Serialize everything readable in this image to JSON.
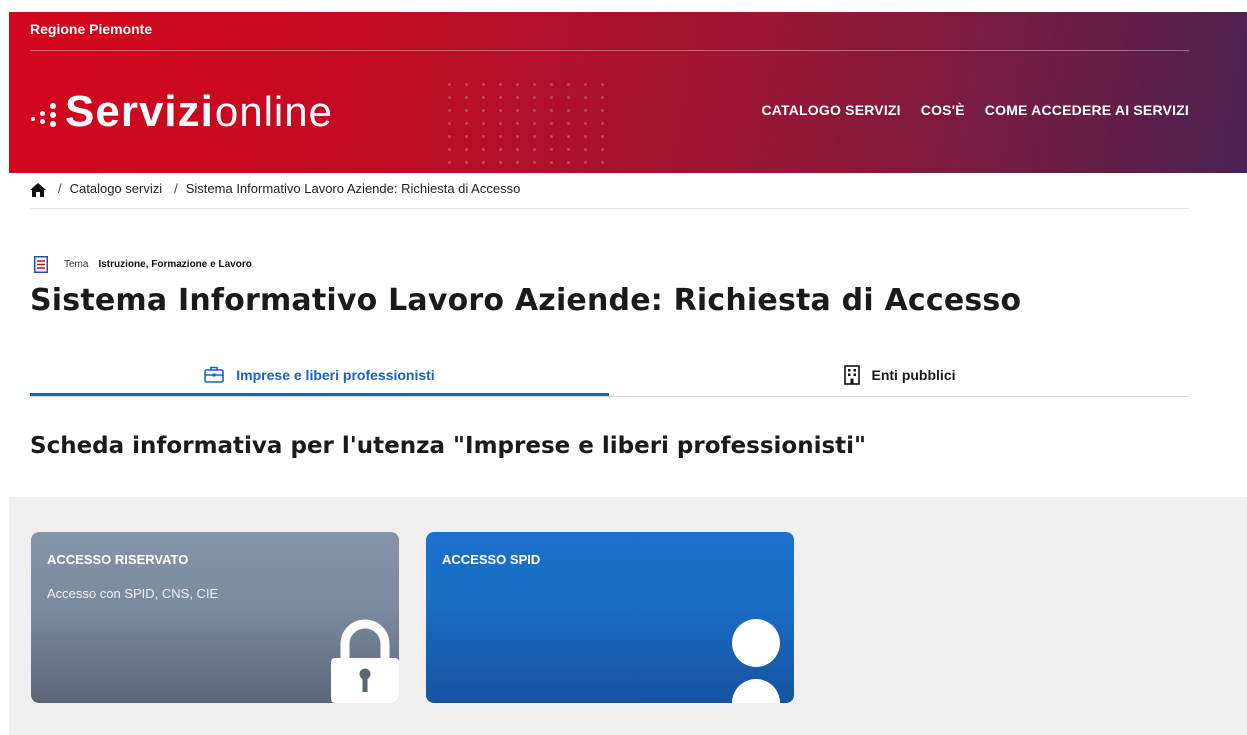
{
  "header": {
    "region": "Regione Piemonte",
    "logo_bold": "Servizi",
    "logo_light": "online",
    "nav": [
      "CATALOGO SERVIZI",
      "COS'È",
      "COME ACCEDERE AI SERVIZI"
    ],
    "colors": {
      "gradient_start": "#d4061d",
      "gradient_end": "#4a2152"
    }
  },
  "breadcrumb": {
    "home_icon": "home-icon",
    "items": [
      "Catalogo servizi",
      "Sistema Informativo Lavoro Aziende: Richiesta di Accesso"
    ],
    "separator": "/"
  },
  "tema": {
    "icon": "document-list-icon",
    "label": "Tema",
    "value": "Istruzione, Formazione e Lavoro"
  },
  "page_title": "Sistema Informativo Lavoro Aziende: Richiesta di Accesso",
  "tabs": [
    {
      "label": "Imprese e liberi professionisti",
      "icon": "briefcase-icon",
      "active": true
    },
    {
      "label": "Enti pubblici",
      "icon": "building-icon",
      "active": false
    }
  ],
  "subtitle": "Scheda informativa per l'utenza \"Imprese e liberi professionisti\"",
  "cards": [
    {
      "title": "ACCESSO RISERVATO",
      "description": "Accesso con SPID, CNS, CIE",
      "icon": "lock-icon",
      "color": "#7b8a9e"
    },
    {
      "title": "ACCESSO SPID",
      "description": "",
      "icon": "user-icon",
      "color": "#1a6bc4"
    }
  ],
  "colors": {
    "accent": "#1565c0",
    "band_bg": "#efefef"
  }
}
